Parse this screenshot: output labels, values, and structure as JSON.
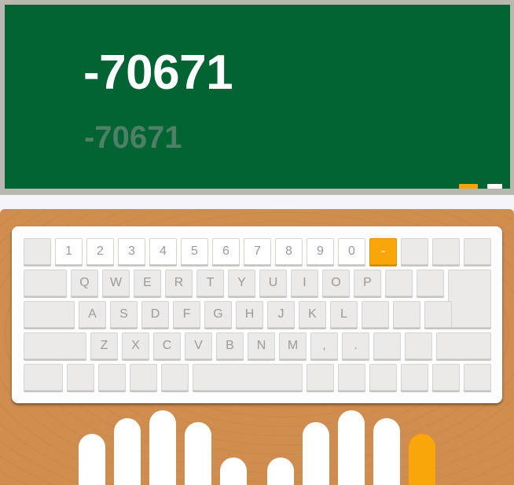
{
  "board": {
    "target": "-70671",
    "typed": "-70671"
  },
  "keyboard": {
    "active_key": "-",
    "rows": [
      [
        "",
        "1",
        "2",
        "3",
        "4",
        "5",
        "6",
        "7",
        "8",
        "9",
        "0",
        "-",
        "",
        "",
        ""
      ],
      [
        "",
        "Q",
        "W",
        "E",
        "R",
        "T",
        "Y",
        "U",
        "I",
        "O",
        "P",
        "",
        "",
        ""
      ],
      [
        "",
        "A",
        "S",
        "D",
        "F",
        "G",
        "H",
        "J",
        "K",
        "L",
        "",
        "",
        "",
        ""
      ],
      [
        "",
        "Z",
        "X",
        "C",
        "V",
        "B",
        "N",
        "M",
        ",",
        ".",
        "",
        "",
        ""
      ],
      [
        "",
        "",
        "",
        "",
        "",
        "",
        "",
        "",
        "",
        "",
        ""
      ]
    ]
  },
  "hands": {
    "active_finger": "right-pinky"
  },
  "colors": {
    "board": "#026432",
    "accent": "#f9a60a",
    "desk": "#cf8d4f"
  }
}
